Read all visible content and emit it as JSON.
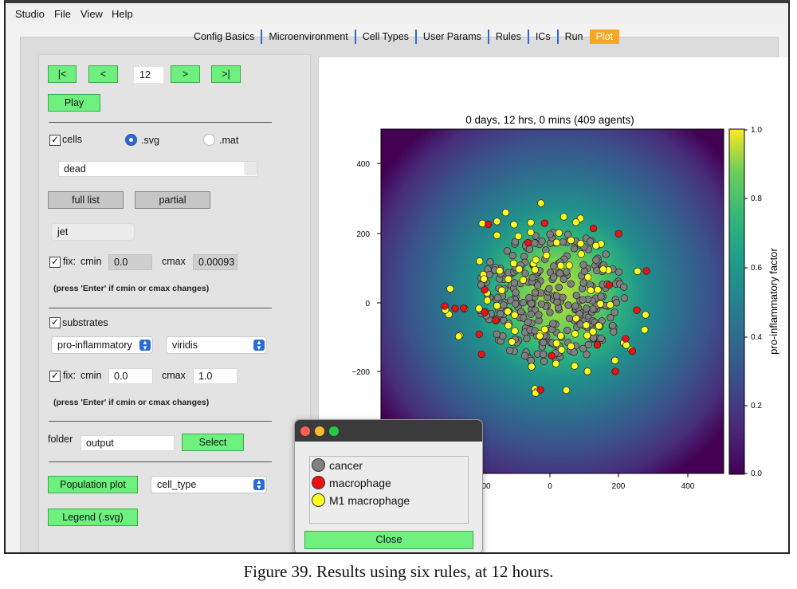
{
  "menu": {
    "items": [
      "Studio",
      "File",
      "View",
      "Help"
    ]
  },
  "tabs": [
    "Config Basics",
    "Microenvironment",
    "Cell Types",
    "User Params",
    "Rules",
    "ICs",
    "Run",
    "Plot"
  ],
  "active_tab": "Plot",
  "controls": {
    "first_label": "|<",
    "prev_label": "<",
    "frame_value": "12",
    "next_label": ">",
    "last_label": ">|",
    "play_label": "Play",
    "cells_label": "cells",
    "cells_checked": true,
    "svg_label": ".svg",
    "mat_label": ".mat",
    "format_selected": ".svg",
    "dead_value": "dead",
    "full_list_label": "full list",
    "partial_label": "partial",
    "cmap1": "jet",
    "fix1_label": "fix:",
    "cmin_label": "cmin",
    "cmin1": "0.0",
    "cmax_label": "cmax",
    "cmax1": "0.00093",
    "press_note": "(press 'Enter' if cmin or cmax changes)",
    "substrates_label": "substrates",
    "substrates_checked": true,
    "substrate_select": "pro-inflammatory",
    "cmap2": "viridis",
    "cmin2": "0.0",
    "cmax2": "1.0",
    "folder_label": "folder",
    "folder_value": "output",
    "select_label": "Select",
    "population_plot_label": "Population plot",
    "population_select": "cell_type",
    "legend_label": "Legend (.svg)"
  },
  "plot": {
    "title": "0 days, 12 hrs, 0 mins (409 agents)",
    "yticks": [
      "400",
      "200",
      "0",
      "−200"
    ],
    "xticks": [
      "00",
      "0",
      "200",
      "400"
    ],
    "colorbar_label": "pro-inflammatory factor",
    "colorbar_ticks": [
      "1.0",
      "0.8",
      "0.6",
      "0.4",
      "0.2",
      "0.0"
    ],
    "colors": {
      "cancer": "#808080",
      "macrophage": "#ee1111",
      "m1": "#ffff22"
    }
  },
  "legend_dialog": {
    "entries": [
      {
        "label": "cancer",
        "color": "#808080"
      },
      {
        "label": "macrophage",
        "color": "#ee1111"
      },
      {
        "label": "M1 macrophage",
        "color": "#ffff22"
      }
    ],
    "close_label": "Close"
  },
  "caption": "Figure 39. Results using six rules, at 12 hours."
}
